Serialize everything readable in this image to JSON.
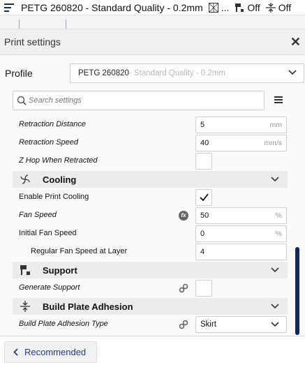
{
  "header": {
    "title": "PETG 260820 - Standard Quality - 0.2mm",
    "ellipsis": "...",
    "support_value": "Off",
    "adhesion_value": "Off"
  },
  "panel": {
    "title": "Print settings",
    "close_glyph": "✕"
  },
  "profile": {
    "label": "Profile",
    "material": "PETG 260820",
    "quality_suffix": " - Standard Quality - 0.2mm"
  },
  "search": {
    "placeholder": "Search settings"
  },
  "settings": {
    "retraction_distance": {
      "label": "Retraction Distance",
      "value": "5",
      "unit": "mm"
    },
    "retraction_speed": {
      "label": "Retraction Speed",
      "value": "40",
      "unit": "mm/s"
    },
    "z_hop": {
      "label": "Z Hop When Retracted",
      "checked": false
    },
    "cooling": {
      "title": "Cooling",
      "enable_print_cooling": {
        "label": "Enable Print Cooling",
        "checked": true
      },
      "fan_speed": {
        "label": "Fan Speed",
        "value": "50",
        "unit": "%"
      },
      "initial_fan_speed": {
        "label": "Initial Fan Speed",
        "value": "0",
        "unit": "%"
      },
      "regular_fan_speed_layer": {
        "label": "Regular Fan Speed at Layer",
        "value": "4"
      }
    },
    "support": {
      "title": "Support",
      "generate_support": {
        "label": "Generate Support",
        "checked": false
      }
    },
    "adhesion": {
      "title": "Build Plate Adhesion",
      "type": {
        "label": "Build Plate Adhesion Type",
        "value": "Skirt"
      }
    }
  },
  "footer": {
    "recommended_label": "Recommended"
  },
  "colors": {
    "accent": "#24398a",
    "scrollbar": "#16245c",
    "category_bg": "#ececec"
  },
  "icons": {
    "printer": "printer-icon",
    "support": "support-icon",
    "adhesion": "adhesion-icon",
    "cooling": "fan-icon",
    "link": "link-icon",
    "function": "function-icon",
    "search": "search-icon",
    "menu": "menu-icon"
  }
}
